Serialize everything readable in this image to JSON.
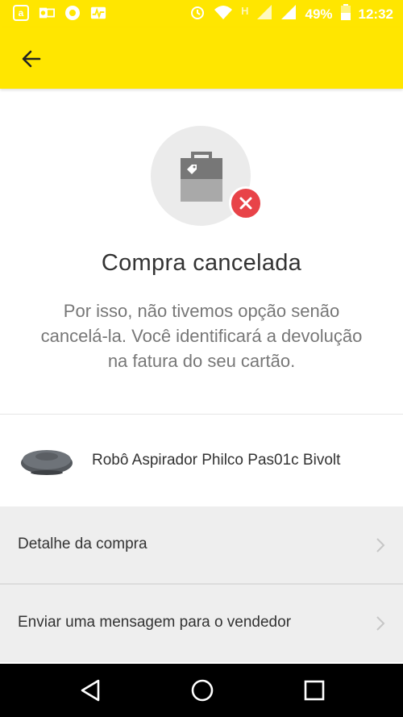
{
  "status_bar": {
    "battery_percent": "49%",
    "time": "12:32",
    "network_label": "H",
    "icons": [
      "amazon-icon",
      "outlook-icon",
      "chrome-icon",
      "activity-icon",
      "alarm-icon",
      "wifi-icon",
      "signal-icon",
      "battery-icon"
    ]
  },
  "app_bar": {
    "back_icon": "arrow-left-icon"
  },
  "status": {
    "title": "Compra cancelada",
    "message": "Por isso, não tivemos opção senão cancelá-la. Você identificará a devolução na fatura do seu cartão."
  },
  "product": {
    "name": "Robô Aspirador Philco Pas01c Bivolt"
  },
  "actions": [
    {
      "label": "Detalhe da compra"
    },
    {
      "label": "Enviar uma mensagem para o vendedor"
    }
  ],
  "colors": {
    "brand_yellow": "#ffe600",
    "error_red": "#e84348"
  }
}
